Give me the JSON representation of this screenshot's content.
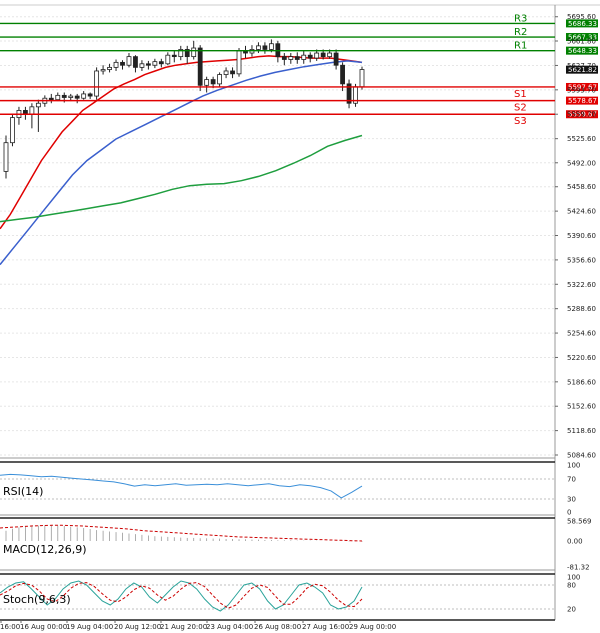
{
  "chart_data": {
    "type": "candlestick",
    "instrument_note": "",
    "x_labels": [
      "16:00",
      "16 Aug 00:00",
      "19 Aug 04:00",
      "20 Aug 12:00",
      "21 Aug 20:00",
      "23 Aug 04:00",
      "26 Aug 08:00",
      "27 Aug 16:00",
      "29 Aug 00:00"
    ],
    "y_ticks": [
      "5695.60",
      "5661.80",
      "5627.70",
      "5593.70",
      "5559.70",
      "5525.60",
      "5492.00",
      "5458.60",
      "5424.60",
      "5390.60",
      "5356.60",
      "5322.60",
      "5288.60",
      "5254.60",
      "5220.60",
      "5186.60",
      "5152.60",
      "5118.60",
      "5084.60"
    ],
    "ylim": [
      5084.6,
      5705
    ],
    "last_price": "5621.82",
    "levels": [
      {
        "name": "R3",
        "value": 5686.33,
        "label": "5686.33",
        "color": "#008000"
      },
      {
        "name": "R2",
        "value": 5667.33,
        "label": "5667.33",
        "color": "#008000"
      },
      {
        "name": "R1",
        "value": 5648.33,
        "label": "5648.33",
        "color": "#008000"
      },
      {
        "name": "S1",
        "value": 5597.67,
        "label": "5597.67",
        "color": "#e00000"
      },
      {
        "name": "S2",
        "value": 5578.67,
        "label": "5578.67",
        "color": "#e00000"
      },
      {
        "name": "S3",
        "value": 5559.67,
        "label": "5559.67",
        "color": "#e00000"
      }
    ],
    "candles": [
      [
        5480,
        5520,
        5470,
        5530
      ],
      [
        5520,
        5555,
        5515,
        5560
      ],
      [
        5555,
        5565,
        5545,
        5570
      ],
      [
        5565,
        5560,
        5552,
        5570
      ],
      [
        5560,
        5570,
        5540,
        5575
      ],
      [
        5570,
        5575,
        5535,
        5580
      ],
      [
        5575,
        5582,
        5570,
        5586
      ],
      [
        5582,
        5580,
        5575,
        5588
      ],
      [
        5580,
        5586,
        5578,
        5590
      ],
      [
        5586,
        5583,
        5576,
        5590
      ],
      [
        5583,
        5585,
        5578,
        5588
      ],
      [
        5585,
        5582,
        5575,
        5588
      ],
      [
        5582,
        5588,
        5580,
        5592
      ],
      [
        5588,
        5585,
        5581,
        5590
      ],
      [
        5585,
        5620,
        5580,
        5625
      ],
      [
        5620,
        5622,
        5615,
        5628
      ],
      [
        5622,
        5625,
        5618,
        5630
      ],
      [
        5625,
        5632,
        5620,
        5636
      ],
      [
        5632,
        5628,
        5622,
        5635
      ],
      [
        5628,
        5640,
        5625,
        5645
      ],
      [
        5640,
        5625,
        5618,
        5642
      ],
      [
        5625,
        5630,
        5620,
        5635
      ],
      [
        5630,
        5628,
        5622,
        5634
      ],
      [
        5628,
        5633,
        5624,
        5637
      ],
      [
        5633,
        5630,
        5625,
        5637
      ],
      [
        5630,
        5642,
        5628,
        5646
      ],
      [
        5642,
        5640,
        5632,
        5648
      ],
      [
        5640,
        5650,
        5635,
        5655
      ],
      [
        5650,
        5640,
        5630,
        5655
      ],
      [
        5640,
        5652,
        5636,
        5662
      ],
      [
        5652,
        5600,
        5592,
        5656
      ],
      [
        5600,
        5608,
        5590,
        5612
      ],
      [
        5608,
        5602,
        5596,
        5612
      ],
      [
        5602,
        5615,
        5598,
        5618
      ],
      [
        5615,
        5620,
        5610,
        5625
      ],
      [
        5620,
        5616,
        5610,
        5625
      ],
      [
        5616,
        5648,
        5612,
        5652
      ],
      [
        5648,
        5645,
        5638,
        5655
      ],
      [
        5645,
        5650,
        5640,
        5656
      ],
      [
        5650,
        5655,
        5645,
        5660
      ],
      [
        5655,
        5650,
        5644,
        5660
      ],
      [
        5650,
        5658,
        5646,
        5664
      ],
      [
        5658,
        5640,
        5632,
        5662
      ],
      [
        5640,
        5636,
        5628,
        5645
      ],
      [
        5636,
        5640,
        5630,
        5645
      ],
      [
        5640,
        5636,
        5630,
        5646
      ],
      [
        5636,
        5642,
        5630,
        5648
      ],
      [
        5642,
        5638,
        5632,
        5646
      ],
      [
        5638,
        5645,
        5634,
        5650
      ],
      [
        5645,
        5640,
        5636,
        5650
      ],
      [
        5640,
        5645,
        5637,
        5650
      ],
      [
        5645,
        5628,
        5622,
        5650
      ],
      [
        5628,
        5602,
        5592,
        5632
      ],
      [
        5602,
        5575,
        5568,
        5608
      ],
      [
        5575,
        5598,
        5570,
        5602
      ],
      [
        5598,
        5622,
        5594,
        5626
      ]
    ],
    "ma_fast": [
      5400,
      5420,
      5445,
      5470,
      5495,
      5515,
      5535,
      5550,
      5565,
      5575,
      5585,
      5595,
      5602,
      5608,
      5615,
      5620,
      5625,
      5628,
      5630,
      5632,
      5633,
      5634,
      5635,
      5636,
      5638,
      5640,
      5641,
      5640,
      5640,
      5639,
      5638,
      5638,
      5638,
      5636,
      5634,
      5632
    ],
    "ma_mid": [
      5350,
      5375,
      5400,
      5425,
      5450,
      5475,
      5495,
      5510,
      5525,
      5535,
      5545,
      5555,
      5565,
      5575,
      5585,
      5593,
      5600,
      5607,
      5613,
      5618,
      5622,
      5626,
      5629,
      5632,
      5634,
      5632
    ],
    "ma_slow": [
      5410,
      5413,
      5416,
      5420,
      5424,
      5428,
      5432,
      5436,
      5442,
      5448,
      5455,
      5460,
      5462,
      5463,
      5467,
      5473,
      5481,
      5491,
      5502,
      5515,
      5523,
      5530
    ],
    "rsi": {
      "label": "RSI(14)",
      "ticks": [
        "100",
        "70",
        "30",
        "0"
      ],
      "values": [
        78,
        80,
        79,
        77,
        75,
        76,
        74,
        72,
        70,
        68,
        66,
        64,
        60,
        55,
        58,
        56,
        58,
        60,
        57,
        58,
        59,
        58,
        60,
        58,
        56,
        58,
        60,
        56,
        54,
        58,
        56,
        52,
        45,
        30,
        42,
        55
      ]
    },
    "macd": {
      "label": "MACD(12,26,9)",
      "ticks": [
        "58.569",
        "0.00",
        "-81.32"
      ],
      "hist": [
        30,
        36,
        40,
        42,
        44,
        45,
        46,
        46,
        45,
        44,
        42,
        40,
        38,
        35,
        32,
        30,
        28,
        26,
        24,
        22,
        20,
        18,
        16,
        14,
        13,
        12,
        11,
        10,
        9,
        9,
        8,
        8,
        7,
        7,
        6,
        6,
        5,
        5,
        4,
        4,
        3,
        3,
        2,
        2,
        2,
        1,
        1,
        1,
        1,
        0,
        0,
        0,
        0,
        -1,
        -1,
        -2
      ],
      "signal": [
        38,
        40,
        42,
        44,
        45,
        46,
        46,
        45,
        44,
        42,
        40,
        38,
        36,
        33,
        30,
        28,
        26,
        24,
        22,
        20,
        18,
        16,
        14,
        12,
        11,
        10,
        9,
        8,
        7,
        6,
        5,
        4,
        3,
        2,
        1,
        0
      ]
    },
    "stoch": {
      "label": "Stoch(9,6,3)",
      "ticks": [
        "100",
        "80",
        "20"
      ],
      "k": [
        60,
        75,
        85,
        88,
        70,
        50,
        30,
        45,
        70,
        85,
        90,
        80,
        60,
        40,
        30,
        45,
        70,
        85,
        75,
        50,
        35,
        55,
        75,
        90,
        85,
        70,
        45,
        25,
        15,
        30,
        55,
        80,
        85,
        70,
        40,
        20,
        30,
        55,
        80,
        85,
        75,
        60,
        30,
        20,
        25,
        40,
        75
      ],
      "d": [
        55,
        65,
        78,
        84,
        80,
        65,
        45,
        38,
        52,
        72,
        84,
        86,
        76,
        58,
        42,
        38,
        50,
        68,
        78,
        72,
        55,
        42,
        52,
        70,
        84,
        86,
        76,
        55,
        35,
        22,
        30,
        52,
        72,
        80,
        74,
        52,
        32,
        32,
        50,
        72,
        82,
        78,
        62,
        42,
        28,
        26,
        45
      ]
    }
  }
}
